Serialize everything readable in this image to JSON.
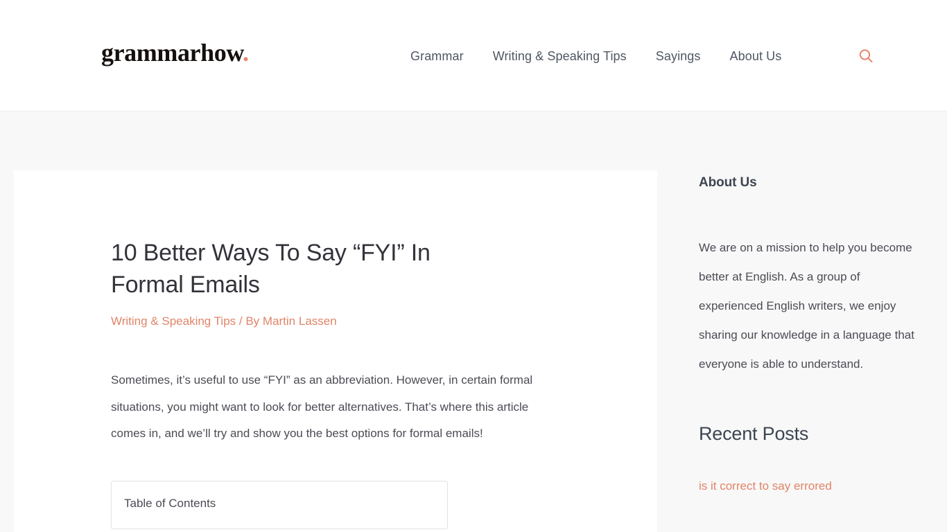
{
  "header": {
    "logo_text": "grammarhow",
    "logo_dot": ".",
    "nav": [
      {
        "label": "Grammar"
      },
      {
        "label": "Writing & Speaking Tips"
      },
      {
        "label": "Sayings"
      },
      {
        "label": "About Us"
      }
    ],
    "search_icon": "search-icon"
  },
  "article": {
    "title": "10 Better Ways To Say “FYI” In Formal Emails",
    "category": "Writing & Speaking Tips",
    "byline_separator": " / ",
    "author_prefix": "By ",
    "author": "Martin Lassen",
    "byline": "Writing & Speaking Tips / By Martin Lassen",
    "intro_paragraph": "Sometimes, it’s useful to use “FYI” as an abbreviation. However, in certain formal situations, you might want to look for better alternatives. That’s where this article comes in, and we’ll try and show you the best options for formal emails!",
    "toc_title": "Table of Contents"
  },
  "sidebar": {
    "about_heading": "About Us",
    "about_text": "We are on a mission to help you become better at English. As a group of experienced English writers, we enjoy sharing our knowledge in a language that everyone is able to understand.",
    "recent_heading": "Recent Posts",
    "recent_posts": [
      {
        "title": "is it correct to say errored"
      }
    ]
  },
  "colors": {
    "accent": "#e8836a",
    "link": "#e08468",
    "text": "#4b4b54",
    "heading": "#32323a",
    "nav_text": "#4f5763",
    "page_bg": "#f8f8f8",
    "card_bg": "#ffffff",
    "border": "#e2e2e2"
  }
}
